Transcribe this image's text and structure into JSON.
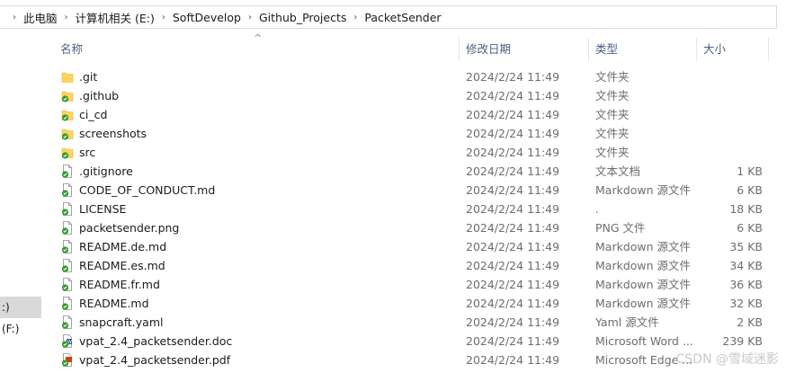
{
  "breadcrumb": [
    "此电脑",
    "计算机相关 (E:)",
    "SoftDevelop",
    "Github_Projects",
    "PacketSender"
  ],
  "nav": {
    "selected_item": ":)",
    "item2": "(F:)"
  },
  "columns": {
    "name": "名称",
    "date": "修改日期",
    "type": "类型",
    "size": "大小"
  },
  "files": [
    {
      "name": ".git",
      "date": "2024/2/24 11:49",
      "type": "文件夹",
      "size": "",
      "icon": "folder-plain"
    },
    {
      "name": ".github",
      "date": "2024/2/24 11:49",
      "type": "文件夹",
      "size": "",
      "icon": "folder-check"
    },
    {
      "name": "ci_cd",
      "date": "2024/2/24 11:49",
      "type": "文件夹",
      "size": "",
      "icon": "folder-check"
    },
    {
      "name": "screenshots",
      "date": "2024/2/24 11:49",
      "type": "文件夹",
      "size": "",
      "icon": "folder-check"
    },
    {
      "name": "src",
      "date": "2024/2/24 11:49",
      "type": "文件夹",
      "size": "",
      "icon": "folder-check"
    },
    {
      "name": ".gitignore",
      "date": "2024/2/24 11:49",
      "type": "文本文档",
      "size": "1 KB",
      "icon": "file-check"
    },
    {
      "name": "CODE_OF_CONDUCT.md",
      "date": "2024/2/24 11:49",
      "type": "Markdown 源文件",
      "size": "6 KB",
      "icon": "file-check"
    },
    {
      "name": "LICENSE",
      "date": "2024/2/24 11:49",
      "type": ".",
      "size": "18 KB",
      "icon": "file-check"
    },
    {
      "name": "packetsender.png",
      "date": "2024/2/24 11:49",
      "type": "PNG 文件",
      "size": "6 KB",
      "icon": "file-check"
    },
    {
      "name": "README.de.md",
      "date": "2024/2/24 11:49",
      "type": "Markdown 源文件",
      "size": "35 KB",
      "icon": "file-check"
    },
    {
      "name": "README.es.md",
      "date": "2024/2/24 11:49",
      "type": "Markdown 源文件",
      "size": "34 KB",
      "icon": "file-check"
    },
    {
      "name": "README.fr.md",
      "date": "2024/2/24 11:49",
      "type": "Markdown 源文件",
      "size": "36 KB",
      "icon": "file-check"
    },
    {
      "name": "README.md",
      "date": "2024/2/24 11:49",
      "type": "Markdown 源文件",
      "size": "32 KB",
      "icon": "file-check"
    },
    {
      "name": "snapcraft.yaml",
      "date": "2024/2/24 11:49",
      "type": "Yaml 源文件",
      "size": "2 KB",
      "icon": "file-check"
    },
    {
      "name": "vpat_2.4_packetsender.doc",
      "date": "2024/2/24 11:49",
      "type": "Microsoft Word ...",
      "size": "239 KB",
      "icon": "word-check"
    },
    {
      "name": "vpat_2.4_packetsender.pdf",
      "date": "2024/2/24 11:49",
      "type": "Microsoft Edge ...",
      "size": "",
      "icon": "pdf-check"
    }
  ],
  "watermark": "CSDN @雪域迷影",
  "colors": {
    "folder": "#ffd35c",
    "folder_edge": "#e6b23a",
    "check": "#2e9a2e",
    "header_text": "#4d6082",
    "selected": "#d9d9d9"
  }
}
